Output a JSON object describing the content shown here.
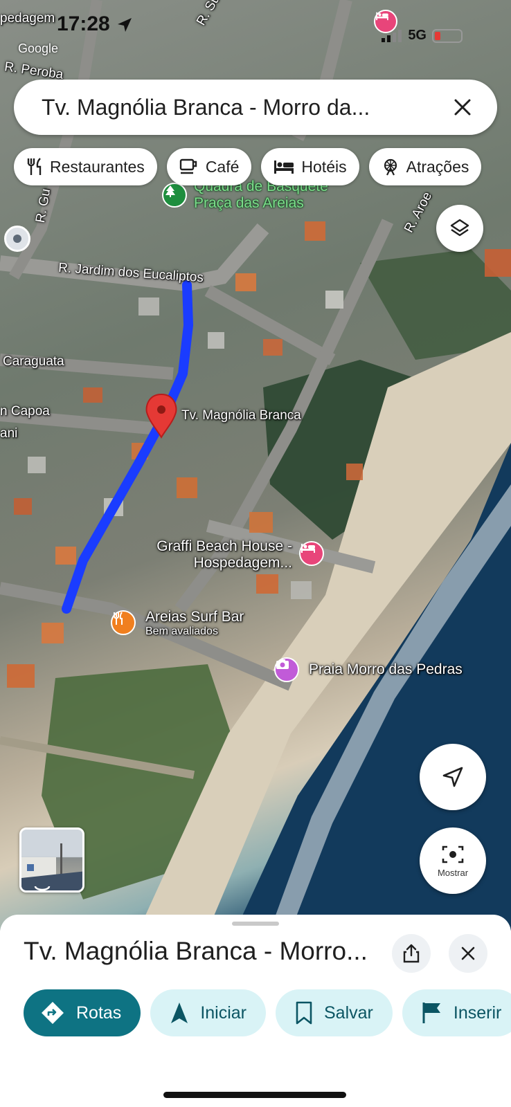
{
  "status_bar": {
    "time": "17:28",
    "network": "5G",
    "battery_level": 0.15
  },
  "map": {
    "attribution": "Google",
    "streets": [
      "R. Jardim dos Eucaliptos",
      "Caraguata",
      "n Capoa",
      "ani",
      "R. Peroba",
      "R. Sucupira",
      "R. Gu",
      "R. Aroe",
      "pedagem"
    ],
    "selected_street": {
      "name": "Tv. Magnólia Branca"
    },
    "pois": [
      {
        "name": "Quadra de Basquete Praça das Areias",
        "line1": "Quadra de Basquete",
        "line2": "Praça das Areias",
        "type": "park",
        "color": "#1e8e3e"
      },
      {
        "name": "Graffi Beach House - Hospedagem...",
        "line1": "Graffi Beach House -",
        "line2": "Hospedagem...",
        "type": "hotel",
        "color": "#e8457a"
      },
      {
        "name": "Areias Surf Bar",
        "line1": "Areias Surf Bar",
        "line2": "Bem avaliados",
        "type": "restaurant",
        "color": "#f07f1f"
      },
      {
        "name": "Praia Morro das Pedras",
        "line1": "Praia Morro das Pedras",
        "type": "attraction",
        "color": "#c15bd8"
      }
    ],
    "route_color": "#1a3cff",
    "pin_color": "#e53935"
  },
  "search": {
    "value": "Tv. Magnólia Branca - Morro da..."
  },
  "chips": [
    {
      "label": "Restaurantes",
      "icon": "fork-knife-icon"
    },
    {
      "label": "Café",
      "icon": "coffee-cup-icon"
    },
    {
      "label": "Hotéis",
      "icon": "bed-icon"
    },
    {
      "label": "Atrações",
      "icon": "ferris-wheel-icon"
    }
  ],
  "controls": {
    "mostrar_label": "Mostrar"
  },
  "sheet": {
    "title": "Tv. Magnólia Branca - Morro...",
    "actions": [
      {
        "label": "Rotas",
        "icon": "directions-icon"
      },
      {
        "label": "Iniciar",
        "icon": "navigation-arrow-icon"
      },
      {
        "label": "Salvar",
        "icon": "bookmark-icon"
      },
      {
        "label": "Inserir",
        "icon": "flag-icon"
      }
    ]
  }
}
